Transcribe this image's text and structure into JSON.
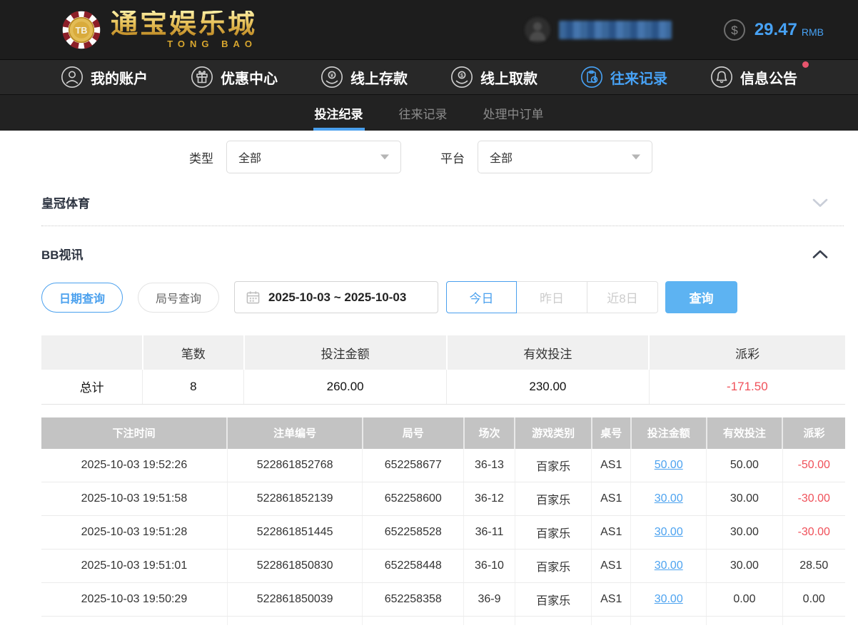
{
  "header": {
    "brand": {
      "chip_text": "TB",
      "wordmark": "通宝娱乐城",
      "wordmark_sub": "TONG BAO"
    },
    "balance": {
      "amount": "29.47",
      "currency": "RMB"
    }
  },
  "nav": {
    "items": [
      {
        "label": "我的账户",
        "icon": "user-icon",
        "active": false
      },
      {
        "label": "优惠中心",
        "icon": "gift-icon",
        "active": false
      },
      {
        "label": "线上存款",
        "icon": "deposit-icon",
        "active": false
      },
      {
        "label": "线上取款",
        "icon": "withdraw-icon",
        "active": false
      },
      {
        "label": "往来记录",
        "icon": "records-icon",
        "active": true
      },
      {
        "label": "信息公告",
        "icon": "bell-icon",
        "active": false,
        "badge": true
      }
    ]
  },
  "subtabs": {
    "bet_records": "投注纪录",
    "transaction_records": "往来记录",
    "pending_orders": "处理中订单"
  },
  "filters": {
    "type_label": "类型",
    "type_value": "全部",
    "platform_label": "平台",
    "platform_value": "全部"
  },
  "sections": {
    "crown_sports": "皇冠体育",
    "bb_video": "BB视讯"
  },
  "query": {
    "date_query": "日期查询",
    "round_query": "局号查询",
    "date_range": "2025-10-03 ~ 2025-10-03",
    "today": "今日",
    "yesterday": "昨日",
    "last8days": "近8日",
    "search": "查询"
  },
  "summary": {
    "headers": [
      "",
      "笔数",
      "投注金额",
      "有效投注",
      "派彩"
    ],
    "row_label": "总计",
    "count": "8",
    "bet_amount": "260.00",
    "valid_bet": "230.00",
    "payout": "-171.50"
  },
  "table": {
    "headers": [
      "下注时间",
      "注单编号",
      "局号",
      "场次",
      "游戏类别",
      "桌号",
      "投注金额",
      "有效投注",
      "派彩"
    ],
    "rows": [
      [
        "2025-10-03 19:52:26",
        "522861852768",
        "652258677",
        "36-13",
        "百家乐",
        "AS1",
        "50.00",
        "50.00",
        "-50.00"
      ],
      [
        "2025-10-03 19:51:58",
        "522861852139",
        "652258600",
        "36-12",
        "百家乐",
        "AS1",
        "30.00",
        "30.00",
        "-30.00"
      ],
      [
        "2025-10-03 19:51:28",
        "522861851445",
        "652258528",
        "36-11",
        "百家乐",
        "AS1",
        "30.00",
        "30.00",
        "-30.00"
      ],
      [
        "2025-10-03 19:51:01",
        "522861850830",
        "652258448",
        "36-10",
        "百家乐",
        "AS1",
        "30.00",
        "30.00",
        "28.50"
      ],
      [
        "2025-10-03 19:50:29",
        "522861850039",
        "652258358",
        "36-9",
        "百家乐",
        "AS1",
        "30.00",
        "0.00",
        "0.00"
      ]
    ]
  },
  "colors": {
    "accent_blue": "#4aa0ee",
    "negative_red": "#f0515a",
    "gold": "#d8a62e",
    "badge_red": "#e8556d"
  }
}
